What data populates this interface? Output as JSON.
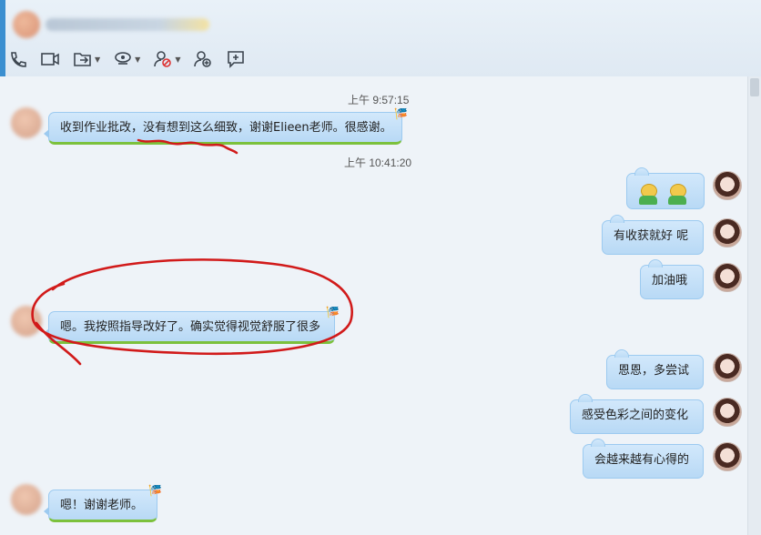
{
  "toolbar": {
    "icons": [
      "phone-icon",
      "video-icon",
      "file-transfer-icon",
      "remote-assist-icon",
      "block-user-icon",
      "add-contact-icon",
      "more-apps-icon"
    ]
  },
  "messages": [
    {
      "kind": "time",
      "text": "上午 9:57:15"
    },
    {
      "kind": "left",
      "text": "收到作业批改，没有想到这么细致，谢谢Elieen老师。很感谢。"
    },
    {
      "kind": "time",
      "text": "上午 10:41:20"
    },
    {
      "kind": "right",
      "emoji": true,
      "text": ""
    },
    {
      "kind": "right",
      "text": "有收获就好 呢"
    },
    {
      "kind": "right",
      "text": "加油哦"
    },
    {
      "kind": "left",
      "text": "嗯。我按照指导改好了。确实觉得视觉舒服了很多"
    },
    {
      "kind": "right",
      "text": "恩恩，多尝试"
    },
    {
      "kind": "right",
      "text": "感受色彩之间的变化"
    },
    {
      "kind": "right",
      "text": "会越来越有心得的"
    },
    {
      "kind": "left",
      "text": "嗯！谢谢老师。"
    }
  ],
  "colors": {
    "bubble": "#c6e1f8",
    "accent_line": "#7cc13c",
    "annotation": "#d11a1a"
  }
}
